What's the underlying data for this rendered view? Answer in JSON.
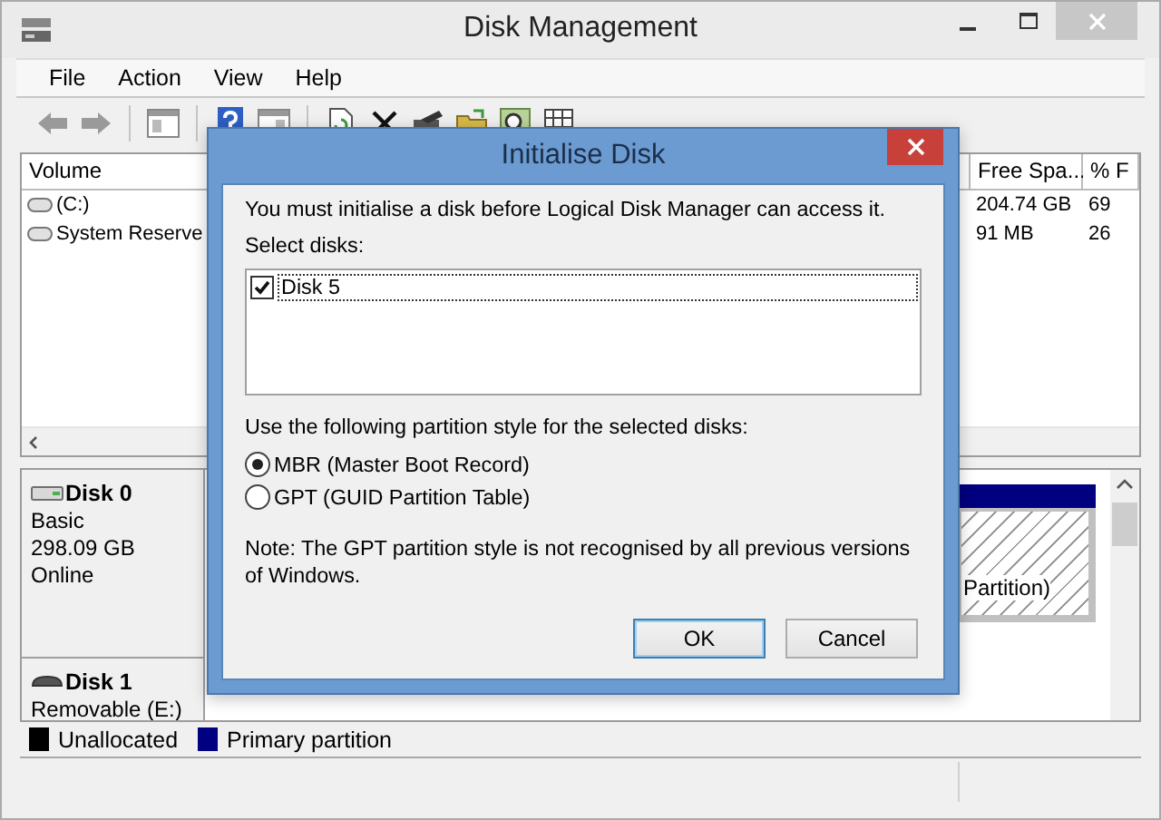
{
  "window": {
    "title": "Disk Management"
  },
  "menu": [
    "File",
    "Action",
    "View",
    "Help"
  ],
  "volume_table": {
    "columns": [
      "Volume",
      "Free Spa...",
      "% F"
    ],
    "rows": [
      {
        "volume": "(C:)",
        "free_space": "204.74 GB",
        "percent_free": "69"
      },
      {
        "volume": "System Reserve",
        "free_space": "91 MB",
        "percent_free": "26"
      }
    ]
  },
  "disks": [
    {
      "name": "Disk 0",
      "kind": "basic",
      "lines": [
        "Basic",
        "298.09 GB",
        "Online"
      ],
      "partition": "Partition)"
    },
    {
      "name": "Disk 1",
      "kind": "removable",
      "lines": [
        "Removable (E:)"
      ]
    }
  ],
  "legend": [
    {
      "label": "Unallocated",
      "color": "#000000"
    },
    {
      "label": "Primary partition",
      "color": "#000080"
    }
  ],
  "dialog": {
    "title": "Initialise Disk",
    "message": "You must initialise a disk before Logical Disk Manager can access it.",
    "select_label": "Select disks:",
    "disks": [
      {
        "label": "Disk 5",
        "checked": true
      }
    ],
    "style_label": "Use the following partition style for the selected disks:",
    "styles": [
      {
        "label": "MBR (Master Boot Record)",
        "selected": true
      },
      {
        "label": "GPT (GUID Partition Table)",
        "selected": false
      }
    ],
    "note": "Note: The GPT partition style is not recognised by all previous versions of Windows.",
    "buttons": [
      {
        "label": "OK",
        "default": true
      },
      {
        "label": "Cancel",
        "default": false
      }
    ]
  }
}
